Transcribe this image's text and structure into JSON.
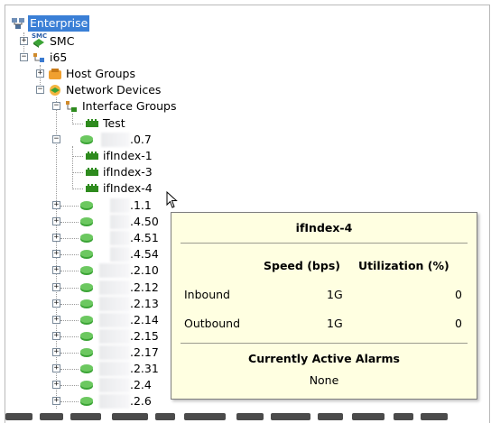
{
  "tree": {
    "root": "Enterprise",
    "smc": "SMC",
    "smc_badge": "SMC",
    "i65": "i65",
    "host_groups": "Host Groups",
    "network_devices": "Network Devices",
    "interface_groups": "Interface Groups",
    "test": "Test",
    "device_07": ".0.7",
    "if1": "ifIndex-1",
    "if3": "ifIndex-3",
    "if4": "ifIndex-4",
    "devices": [
      ".1.1",
      ".4.50",
      ".4.51",
      ".4.54",
      ".2.10",
      ".2.12",
      ".2.13",
      ".2.14",
      ".2.15",
      ".2.17",
      ".2.31",
      ".2.4",
      ".2.6"
    ],
    "expand_symbol": "+",
    "collapse_symbol": "−"
  },
  "tooltip": {
    "title": "ifIndex-4",
    "col_speed": "Speed (bps)",
    "col_util": "Utilization (%)",
    "rows": [
      {
        "label": "Inbound",
        "speed": "1G",
        "util": "0"
      },
      {
        "label": "Outbound",
        "speed": "1G",
        "util": "0"
      }
    ],
    "alarms_title": "Currently Active Alarms",
    "alarms_value": "None"
  },
  "colors": {
    "selection": "#3a7fd6",
    "tooltip_bg": "#ffffe1",
    "device_icon": "#3aa335",
    "interface_icon": "#2e8b1e"
  }
}
